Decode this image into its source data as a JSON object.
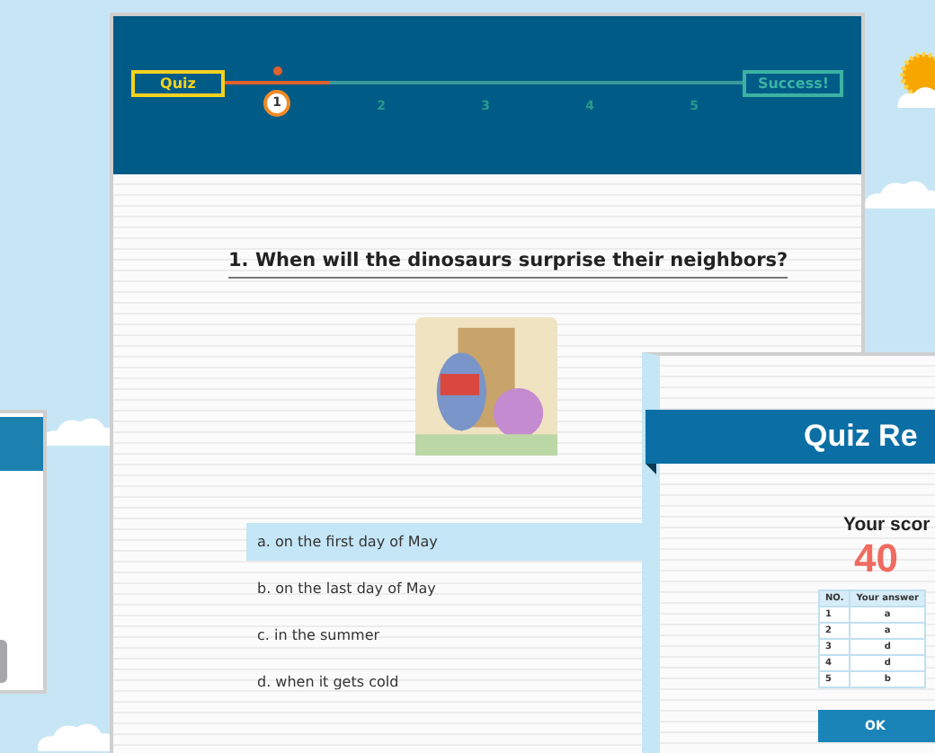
{
  "progress": {
    "start_label": "Quiz",
    "end_label": "Success!",
    "steps": [
      {
        "label": "1",
        "selected": true
      },
      {
        "label": "2",
        "selected": false
      },
      {
        "label": "3",
        "selected": false
      },
      {
        "label": "4",
        "selected": false
      },
      {
        "label": "5",
        "selected": false
      }
    ]
  },
  "question": {
    "text": "1. When will the dinosaurs surprise their neighbors?",
    "options": [
      {
        "label": "a. on the first day of May",
        "selected": true
      },
      {
        "label": "b. on the last day of May",
        "selected": false
      },
      {
        "label": "c. in the summer",
        "selected": false
      },
      {
        "label": "d. when it gets cold",
        "selected": false
      }
    ]
  },
  "results_dialog": {
    "title": "Quiz Re",
    "score_label": "Your scor",
    "score": "40",
    "table": {
      "columns": [
        "NO.",
        "Your answer"
      ],
      "rows": [
        [
          "1",
          "a"
        ],
        [
          "2",
          "a"
        ],
        [
          "3",
          "d"
        ],
        [
          "4",
          "d"
        ],
        [
          "5",
          "b"
        ]
      ]
    },
    "button": "OK"
  }
}
